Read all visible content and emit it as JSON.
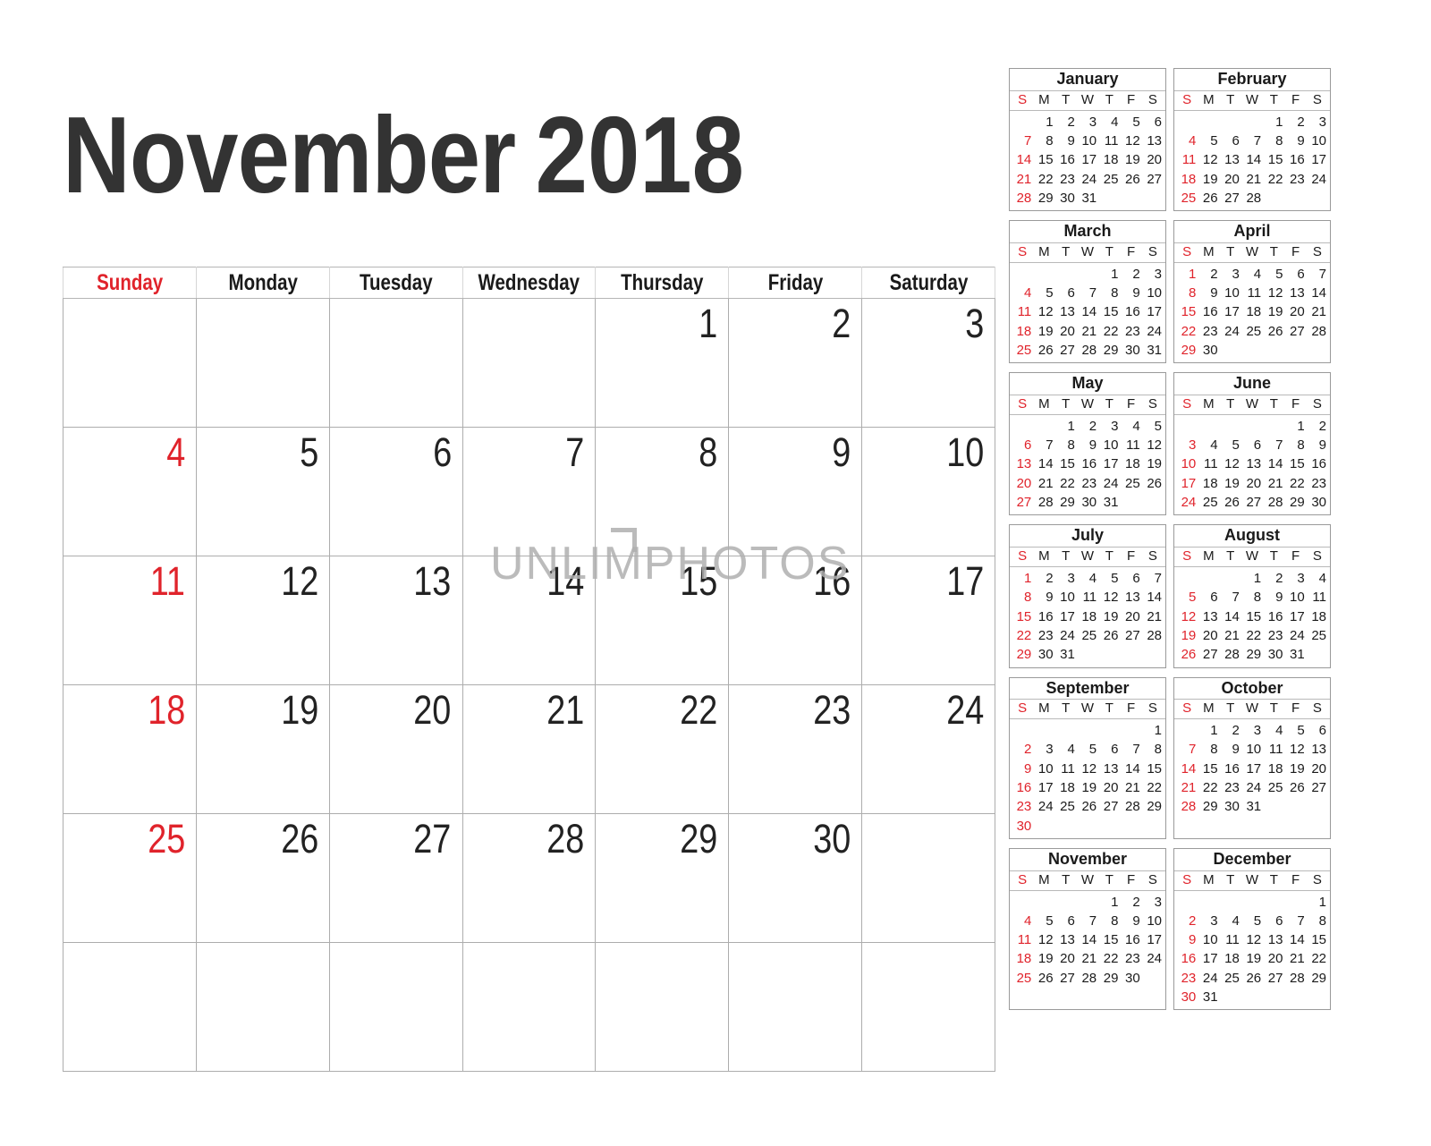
{
  "colors": {
    "sunday_red": "#e0232b",
    "text_dark": "#222222",
    "grid_line": "#adadad",
    "watermark_grey": "#b0b0b0"
  },
  "header": {
    "month": "November",
    "year": "2018"
  },
  "watermark": {
    "text": "UNLIMPHOTOS"
  },
  "main_calendar": {
    "weekday_headers": [
      "Sunday",
      "Monday",
      "Tuesday",
      "Wednesday",
      "Thursday",
      "Friday",
      "Saturday"
    ],
    "weeks": [
      [
        "",
        "",
        "",
        "",
        "1",
        "2",
        "3"
      ],
      [
        "4",
        "5",
        "6",
        "7",
        "8",
        "9",
        "10"
      ],
      [
        "11",
        "12",
        "13",
        "14",
        "15",
        "16",
        "17"
      ],
      [
        "18",
        "19",
        "20",
        "21",
        "22",
        "23",
        "24"
      ],
      [
        "25",
        "26",
        "27",
        "28",
        "29",
        "30",
        ""
      ],
      [
        "",
        "",
        "",
        "",
        "",
        "",
        ""
      ]
    ]
  },
  "mini_calendars": {
    "dow_labels": [
      "S",
      "M",
      "T",
      "W",
      "T",
      "F",
      "S"
    ],
    "months": [
      {
        "name": "January",
        "days": [
          "",
          "1",
          "2",
          "3",
          "4",
          "5",
          "6",
          "7",
          "8",
          "9",
          "10",
          "11",
          "12",
          "13",
          "14",
          "15",
          "16",
          "17",
          "18",
          "19",
          "20",
          "21",
          "22",
          "23",
          "24",
          "25",
          "26",
          "27",
          "28",
          "29",
          "30",
          "31",
          "",
          "",
          ""
        ]
      },
      {
        "name": "February",
        "days": [
          "",
          "",
          "",
          "",
          "1",
          "2",
          "3",
          "4",
          "5",
          "6",
          "7",
          "8",
          "9",
          "10",
          "11",
          "12",
          "13",
          "14",
          "15",
          "16",
          "17",
          "18",
          "19",
          "20",
          "21",
          "22",
          "23",
          "24",
          "25",
          "26",
          "27",
          "28",
          "",
          "",
          ""
        ]
      },
      {
        "name": "March",
        "days": [
          "",
          "",
          "",
          "",
          "1",
          "2",
          "3",
          "4",
          "5",
          "6",
          "7",
          "8",
          "9",
          "10",
          "11",
          "12",
          "13",
          "14",
          "15",
          "16",
          "17",
          "18",
          "19",
          "20",
          "21",
          "22",
          "23",
          "24",
          "25",
          "26",
          "27",
          "28",
          "29",
          "30",
          "31"
        ]
      },
      {
        "name": "April",
        "days": [
          "1",
          "2",
          "3",
          "4",
          "5",
          "6",
          "7",
          "8",
          "9",
          "10",
          "11",
          "12",
          "13",
          "14",
          "15",
          "16",
          "17",
          "18",
          "19",
          "20",
          "21",
          "22",
          "23",
          "24",
          "25",
          "26",
          "27",
          "28",
          "29",
          "30",
          "",
          "",
          "",
          "",
          ""
        ]
      },
      {
        "name": "May",
        "days": [
          "",
          "",
          "1",
          "2",
          "3",
          "4",
          "5",
          "6",
          "7",
          "8",
          "9",
          "10",
          "11",
          "12",
          "13",
          "14",
          "15",
          "16",
          "17",
          "18",
          "19",
          "20",
          "21",
          "22",
          "23",
          "24",
          "25",
          "26",
          "27",
          "28",
          "29",
          "30",
          "31",
          "",
          ""
        ]
      },
      {
        "name": "June",
        "days": [
          "",
          "",
          "",
          "",
          "",
          "1",
          "2",
          "3",
          "4",
          "5",
          "6",
          "7",
          "8",
          "9",
          "10",
          "11",
          "12",
          "13",
          "14",
          "15",
          "16",
          "17",
          "18",
          "19",
          "20",
          "21",
          "22",
          "23",
          "24",
          "25",
          "26",
          "27",
          "28",
          "29",
          "30"
        ]
      },
      {
        "name": "July",
        "days": [
          "1",
          "2",
          "3",
          "4",
          "5",
          "6",
          "7",
          "8",
          "9",
          "10",
          "11",
          "12",
          "13",
          "14",
          "15",
          "16",
          "17",
          "18",
          "19",
          "20",
          "21",
          "22",
          "23",
          "24",
          "25",
          "26",
          "27",
          "28",
          "29",
          "30",
          "31",
          "",
          "",
          "",
          ""
        ]
      },
      {
        "name": "August",
        "days": [
          "",
          "",
          "",
          "1",
          "2",
          "3",
          "4",
          "5",
          "6",
          "7",
          "8",
          "9",
          "10",
          "11",
          "12",
          "13",
          "14",
          "15",
          "16",
          "17",
          "18",
          "19",
          "20",
          "21",
          "22",
          "23",
          "24",
          "25",
          "26",
          "27",
          "28",
          "29",
          "30",
          "31",
          ""
        ]
      },
      {
        "name": "September",
        "days": [
          "",
          "",
          "",
          "",
          "",
          "",
          "1",
          "2",
          "3",
          "4",
          "5",
          "6",
          "7",
          "8",
          "9",
          "10",
          "11",
          "12",
          "13",
          "14",
          "15",
          "16",
          "17",
          "18",
          "19",
          "20",
          "21",
          "22",
          "23",
          "24",
          "25",
          "26",
          "27",
          "28",
          "29",
          "30",
          "",
          "",
          "",
          "",
          "",
          ""
        ]
      },
      {
        "name": "October",
        "days": [
          "",
          "1",
          "2",
          "3",
          "4",
          "5",
          "6",
          "7",
          "8",
          "9",
          "10",
          "11",
          "12",
          "13",
          "14",
          "15",
          "16",
          "17",
          "18",
          "19",
          "20",
          "21",
          "22",
          "23",
          "24",
          "25",
          "26",
          "27",
          "28",
          "29",
          "30",
          "31",
          "",
          "",
          ""
        ]
      },
      {
        "name": "November",
        "days": [
          "",
          "",
          "",
          "",
          "1",
          "2",
          "3",
          "4",
          "5",
          "6",
          "7",
          "8",
          "9",
          "10",
          "11",
          "12",
          "13",
          "14",
          "15",
          "16",
          "17",
          "18",
          "19",
          "20",
          "21",
          "22",
          "23",
          "24",
          "25",
          "26",
          "27",
          "28",
          "29",
          "30",
          ""
        ]
      },
      {
        "name": "December",
        "days": [
          "",
          "",
          "",
          "",
          "",
          "",
          "1",
          "2",
          "3",
          "4",
          "5",
          "6",
          "7",
          "8",
          "9",
          "10",
          "11",
          "12",
          "13",
          "14",
          "15",
          "16",
          "17",
          "18",
          "19",
          "20",
          "21",
          "22",
          "23",
          "24",
          "25",
          "26",
          "27",
          "28",
          "29",
          "30",
          "31",
          "",
          "",
          "",
          "",
          ""
        ]
      }
    ]
  }
}
